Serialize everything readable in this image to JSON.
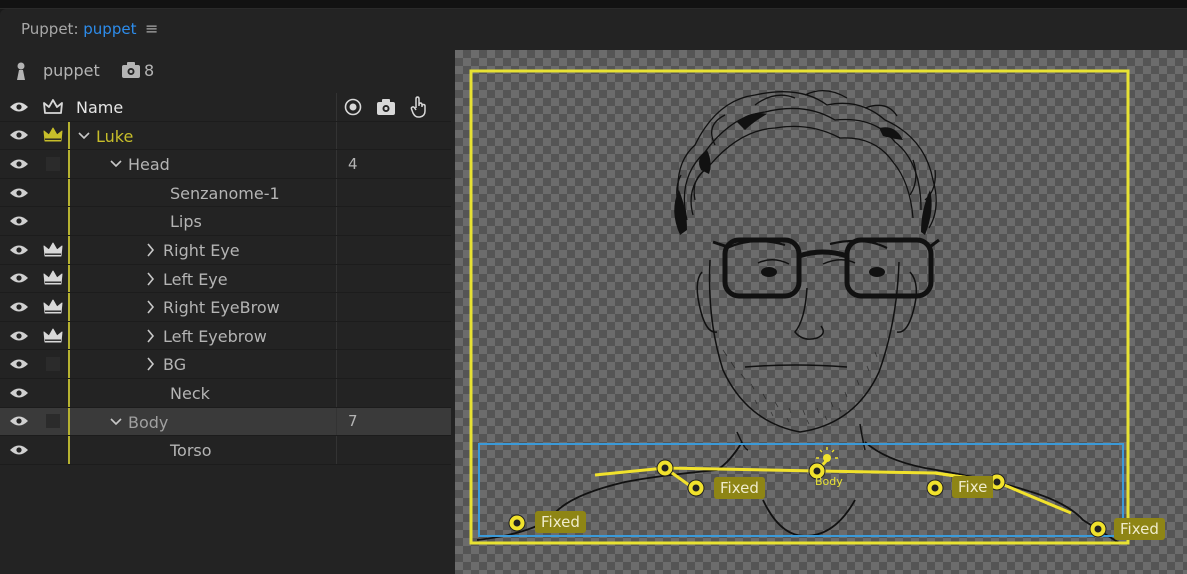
{
  "panel": {
    "title_prefix": "Puppet:",
    "puppet_name": "puppet",
    "menu_icon": "hamburger-menu-icon"
  },
  "puppet_info": {
    "name": "puppet",
    "camera_count": "8"
  },
  "columns": {
    "name": "Name"
  },
  "layers": [
    {
      "name": "Luke",
      "chevron": "down",
      "crown": "gold",
      "num": ""
    },
    {
      "name": "Head",
      "chevron": "down",
      "crown": "square",
      "num": "4"
    },
    {
      "name": "Senzanome-1",
      "chevron": "",
      "crown": "",
      "num": ""
    },
    {
      "name": "Lips",
      "chevron": "",
      "crown": "",
      "num": ""
    },
    {
      "name": "Right Eye",
      "chevron": "right",
      "crown": "white",
      "num": ""
    },
    {
      "name": "Left Eye",
      "chevron": "right",
      "crown": "white",
      "num": ""
    },
    {
      "name": "Right EyeBrow",
      "chevron": "right",
      "crown": "white",
      "num": ""
    },
    {
      "name": "Left Eyebrow",
      "chevron": "right",
      "crown": "white",
      "num": ""
    },
    {
      "name": "BG",
      "chevron": "right",
      "crown": "square",
      "num": ""
    },
    {
      "name": "Neck",
      "chevron": "",
      "crown": "",
      "num": ""
    },
    {
      "name": "Body",
      "chevron": "down",
      "crown": "square",
      "num": "7"
    },
    {
      "name": "Torso",
      "chevron": "",
      "crown": "",
      "num": ""
    }
  ],
  "canvas": {
    "handle_labels": [
      "Fixed",
      "Fixed",
      "Fixe",
      "Fixed"
    ],
    "body_label": "Body",
    "colors": {
      "bounds": "#e8e233",
      "selection": "#3b9ad8",
      "tag_bg": "#8e8515",
      "accent_blue": "#2d8ceb"
    }
  }
}
